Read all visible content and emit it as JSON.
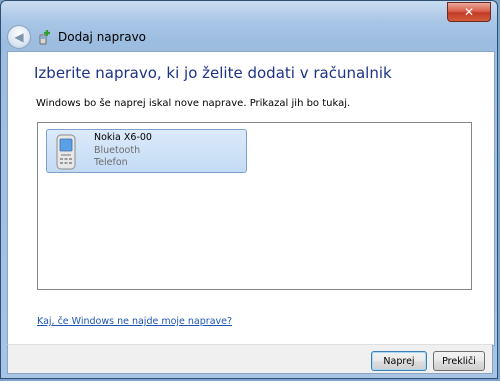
{
  "window": {
    "close_glyph": "✕",
    "close_icon": "close-icon"
  },
  "header": {
    "title": "Dodaj napravo",
    "back_icon": "back-arrow-icon",
    "app_icon": "add-device-icon"
  },
  "main": {
    "heading": "Izberite napravo, ki jo želite dodati v računalnik",
    "description": "Windows bo še naprej iskal nove naprave. Prikazal jih bo tukaj.",
    "devices": [
      {
        "name": "Nokia X6-00",
        "connection": "Bluetooth",
        "category": "Telefon",
        "icon": "mobile-phone-icon"
      }
    ],
    "help_link": "Kaj, če Windows ne najde moje naprave?"
  },
  "footer": {
    "next_label": "Naprej",
    "cancel_label": "Prekliči"
  },
  "colors": {
    "heading": "#1e3287",
    "link": "#1e55b5",
    "selection": "#c3dbf5"
  }
}
